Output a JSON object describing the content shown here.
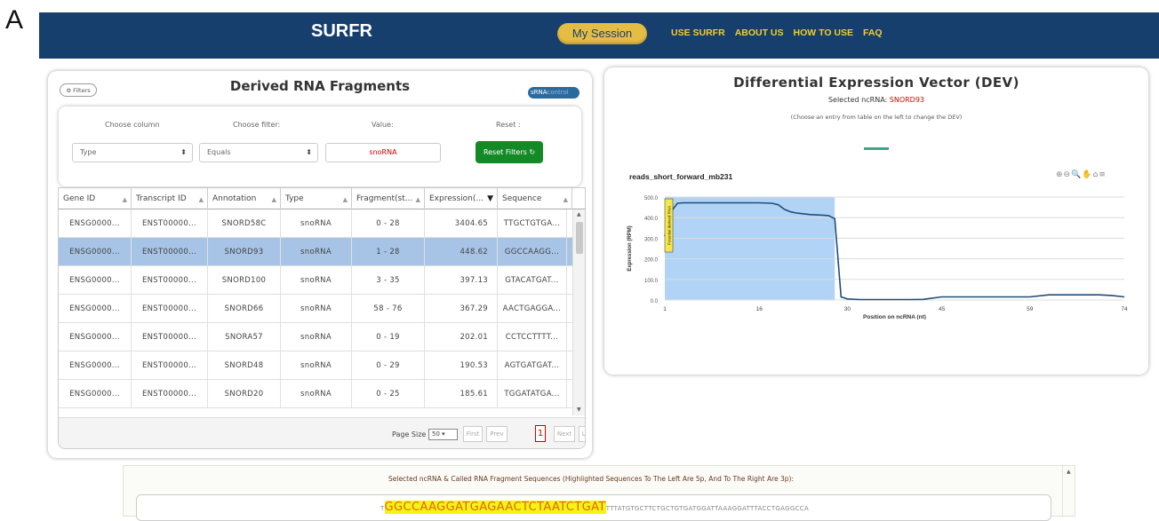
{
  "panel_letter": "A",
  "nav": {
    "brand": "SURFR",
    "session": "My Session",
    "links": [
      "USE SURFR",
      "ABOUT US",
      "HOW TO USE",
      "FAQ"
    ]
  },
  "left_panel": {
    "title": "Derived RNA Fragments",
    "filters_button": "Filters",
    "toggle_on": "sRNA",
    "toggle_off": "control",
    "filter": {
      "labels": [
        "Choose column",
        "Choose filter:",
        "Value:",
        "Reset :"
      ],
      "column_value": "Type",
      "filter_value": "Equals",
      "value": "snoRNA",
      "reset_button": "Reset Filters"
    },
    "table": {
      "columns": [
        "Gene ID",
        "Transcript ID",
        "Annotation",
        "Type",
        "Fragment(st...",
        "Expression(...",
        "Sequence"
      ],
      "rows": [
        [
          "ENSG0000...",
          "ENST00000...",
          "SNORD58C",
          "snoRNA",
          "0 - 28",
          "3404.65",
          "TTGCTGTGA..."
        ],
        [
          "ENSG0000...",
          "ENST00000...",
          "SNORD93",
          "snoRNA",
          "1 - 28",
          "448.62",
          "GGCCAAGG..."
        ],
        [
          "ENSG0000...",
          "ENST00000...",
          "SNORD100",
          "snoRNA",
          "3 - 35",
          "397.13",
          "GTACATGAT..."
        ],
        [
          "ENSG0000...",
          "ENST00000...",
          "SNORD66",
          "snoRNA",
          "58 - 76",
          "367.29",
          "AACTGAGGA..."
        ],
        [
          "ENSG0000...",
          "ENST00000...",
          "SNORA57",
          "snoRNA",
          "0 - 19",
          "202.01",
          "CCTCCTTTT..."
        ],
        [
          "ENSG0000...",
          "ENST00000...",
          "SNORD48",
          "snoRNA",
          "0 - 29",
          "190.53",
          "AGTGATGAT..."
        ],
        [
          "ENSG0000...",
          "ENST00000...",
          "SNORD20",
          "snoRNA",
          "0 - 25",
          "185.61",
          "TGGATATGA..."
        ]
      ],
      "selected_row": 1
    },
    "pager": {
      "label": "Page Size",
      "size": "50",
      "first": "First",
      "prev": "Prev",
      "page": "1",
      "next": "Next",
      "last": "Last"
    }
  },
  "right_panel": {
    "title": "Differential Expression Vector (DEV)",
    "selected_label": "Selected ncRNA: ",
    "selected_value": "SNORD93",
    "note": "(Choose an entry from table on the left to change the DEV)"
  },
  "chart_data": {
    "type": "area",
    "title": "reads_short_forward_mb231",
    "xlabel": "Position on ncRNA (nt)",
    "ylabel": "Expression (RPM)",
    "x_ticks": [
      "1",
      "16",
      "30",
      "45",
      "59",
      "74"
    ],
    "y_ticks": [
      "0.0",
      "100.0",
      "200.0",
      "300.0",
      "400.0",
      "500.0"
    ],
    "xlim": [
      1,
      74
    ],
    "ylim": [
      0,
      500
    ],
    "highlight_range": [
      1,
      28
    ],
    "highlight_label": "Potential derived RNA",
    "series": [
      {
        "x": [
          1,
          2,
          3,
          4,
          6,
          8,
          10,
          12,
          14,
          16,
          18,
          19,
          20,
          21,
          22,
          24,
          26,
          27,
          28,
          29,
          30,
          32,
          34,
          36,
          38,
          40,
          42,
          45,
          48,
          52,
          56,
          59,
          62,
          66,
          70,
          72,
          74
        ],
        "y": [
          310,
          430,
          470,
          472,
          472,
          472,
          472,
          472,
          472,
          472,
          470,
          463,
          440,
          428,
          422,
          415,
          412,
          410,
          395,
          15,
          5,
          2,
          2,
          2,
          2,
          2,
          3,
          15,
          15,
          15,
          15,
          15,
          25,
          25,
          25,
          22,
          15
        ]
      }
    ]
  },
  "sequence_panel": {
    "title": "Selected ncRNA & Called RNA Fragment Sequences (Highlighted Sequences To The Left Are 5p, And To The Right Are 3p):",
    "prefix": "T",
    "highlighted": "GGCCAAGGATGAGAACTCTAATCTGAT",
    "suffix": "TTTATGTGCTTCTGCTGTGATGGATTAAAGGATTTACCTGAGGCCA"
  }
}
